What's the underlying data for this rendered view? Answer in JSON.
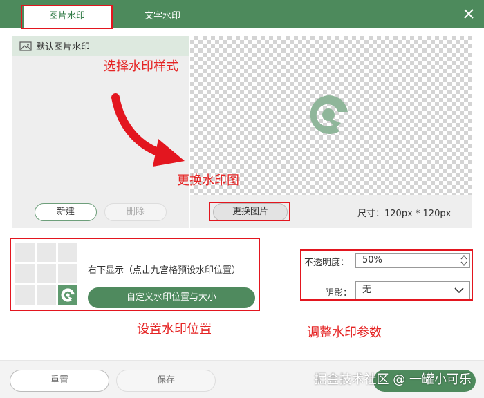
{
  "tabs": [
    {
      "label": "图片水印",
      "active": true
    },
    {
      "label": "文字水印",
      "active": false
    }
  ],
  "style_list": {
    "items": [
      {
        "label": "默认图片水印"
      }
    ]
  },
  "style_buttons": {
    "new_label": "新建",
    "delete_label": "删除"
  },
  "preview": {
    "change_label": "更换图片",
    "size_label": "尺寸：120px * 120px"
  },
  "position": {
    "grid_selected": "bottom-right",
    "status_text": "右下显示（点击九宫格预设水印位置）",
    "custom_button_label": "自定义水印位置与大小"
  },
  "params": {
    "opacity_label": "不透明度：",
    "opacity_value": "50%",
    "shadow_label": "阴影：",
    "shadow_value": "无"
  },
  "annotations": {
    "select_style": "选择水印样式",
    "change_image": "更换水印图",
    "set_position": "设置水印位置",
    "adjust_params": "调整水印参数"
  },
  "footer": {
    "reset_label": "重置",
    "save_label": "保存"
  },
  "site_watermark": "掘金技术社区 @ 一罐小可乐",
  "colors": {
    "brand_green": "#4d8a5c",
    "annotation_red": "#e3161f",
    "logo_green": "#8fb69a"
  }
}
